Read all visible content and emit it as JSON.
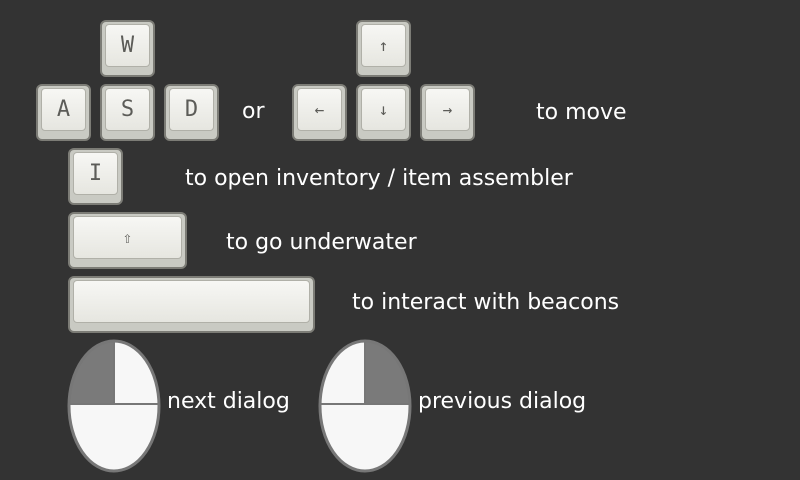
{
  "keys": {
    "w": "W",
    "a": "A",
    "s": "S",
    "d": "D",
    "up": "↑",
    "left": "←",
    "down": "↓",
    "right": "→",
    "i": "I",
    "shift": "⇧",
    "space": ""
  },
  "labels": {
    "or": "or",
    "move": "to move",
    "inventory": "to open inventory / item assembler",
    "underwater": "to go underwater",
    "interact": "to interact with beacons",
    "next_dialog": "next dialog",
    "previous_dialog": "previous dialog"
  },
  "colors": {
    "background": "#333333",
    "key_face": "#f2f2ee",
    "mouse_body": "#f7f7f7",
    "mouse_pressed": "#7a7a7a"
  }
}
